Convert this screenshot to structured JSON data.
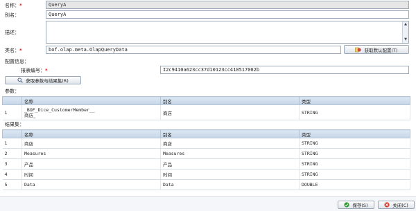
{
  "form": {
    "name_label": "名称：",
    "name_value": "QueryA",
    "alias_label": "别名：",
    "alias_value": "QueryA",
    "desc_label": "描述：",
    "desc_value": "",
    "class_label": "类名：",
    "class_value": "bof.olap.meta.OlapQueryData",
    "get_default_config_button": "获取默认配置(T)",
    "config_info_label": "配置信息：",
    "report_id_label": "报表编号：",
    "report_id_value": "I2c9410a623cc37d10123cc410517002b",
    "get_params_button": "获取参数与结果集(R)",
    "required_mark": "*"
  },
  "params": {
    "section_label": "参数：",
    "columns": [
      "名称",
      "别名",
      "类型"
    ],
    "rows": [
      {
        "num": "1",
        "name_line1": "_BOF_Dice_CustomerMember__",
        "name_line2": "商店_",
        "alias": "商店",
        "type": "STRING"
      }
    ]
  },
  "results": {
    "section_label": "结果集：",
    "columns": [
      "名称",
      "别名",
      "类型"
    ],
    "rows": [
      {
        "num": "1",
        "name": "商店",
        "alias": "商店",
        "type": "STRING"
      },
      {
        "num": "2",
        "name": "Measures",
        "alias": "Measures",
        "type": "STRING"
      },
      {
        "num": "3",
        "name": "产品",
        "alias": "产品",
        "type": "STRING"
      },
      {
        "num": "4",
        "name": "时间",
        "alias": "时间",
        "type": "STRING"
      },
      {
        "num": "5",
        "name": "Data",
        "alias": "Data",
        "type": "DOUBLE"
      }
    ]
  },
  "footer": {
    "save_button": "保存(S)",
    "close_button": "关闭(C)"
  },
  "colors": {
    "required": "#e01010",
    "header_bg": "#c6d6e8",
    "save_icon": "#2e9a2e",
    "close_icon": "#d63a2a"
  }
}
